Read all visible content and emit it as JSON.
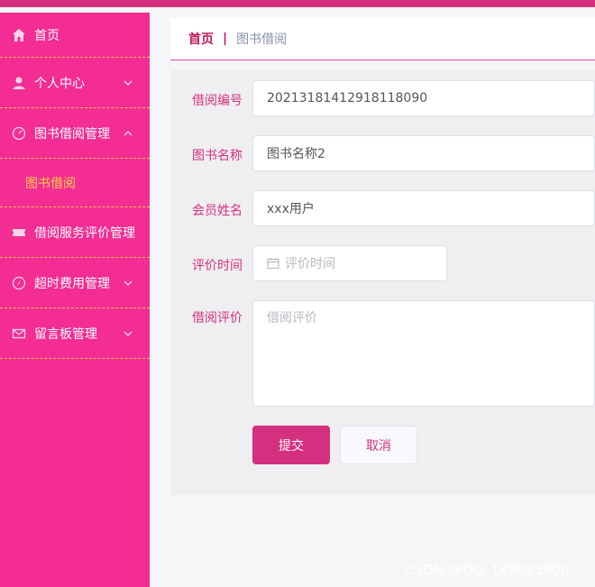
{
  "sidebar": {
    "items": [
      {
        "label": "首页",
        "icon": "home-icon"
      },
      {
        "label": "个人中心",
        "icon": "user-icon"
      },
      {
        "label": "图书借阅管理",
        "icon": "gauge-icon"
      },
      {
        "label": "借阅服务评价管理",
        "icon": "ticket-icon"
      },
      {
        "label": "超时费用管理",
        "icon": "compass-icon"
      },
      {
        "label": "留言板管理",
        "icon": "mail-icon"
      }
    ],
    "submenu": {
      "label": "图书借阅"
    }
  },
  "breadcrumb": {
    "home": "首页",
    "separator": "|",
    "current": "图书借阅"
  },
  "form": {
    "borrow_no": {
      "label": "借阅编号",
      "value": "20213181412918118090"
    },
    "book_name": {
      "label": "图书名称",
      "value": "图书名称2"
    },
    "member_name": {
      "label": "会员姓名",
      "value": "xxx用户"
    },
    "eval_time": {
      "label": "评价时间",
      "placeholder": "评价时间"
    },
    "borrow_eval": {
      "label": "借阅评价",
      "placeholder": "借阅评价"
    }
  },
  "buttons": {
    "submit": "提交",
    "cancel": "取消"
  },
  "watermark": "CSDN @QQ_188083800",
  "colors": {
    "sidebar_bg": "#f32d93",
    "accent": "#d4307f",
    "submenu_text": "#ffd24a"
  }
}
